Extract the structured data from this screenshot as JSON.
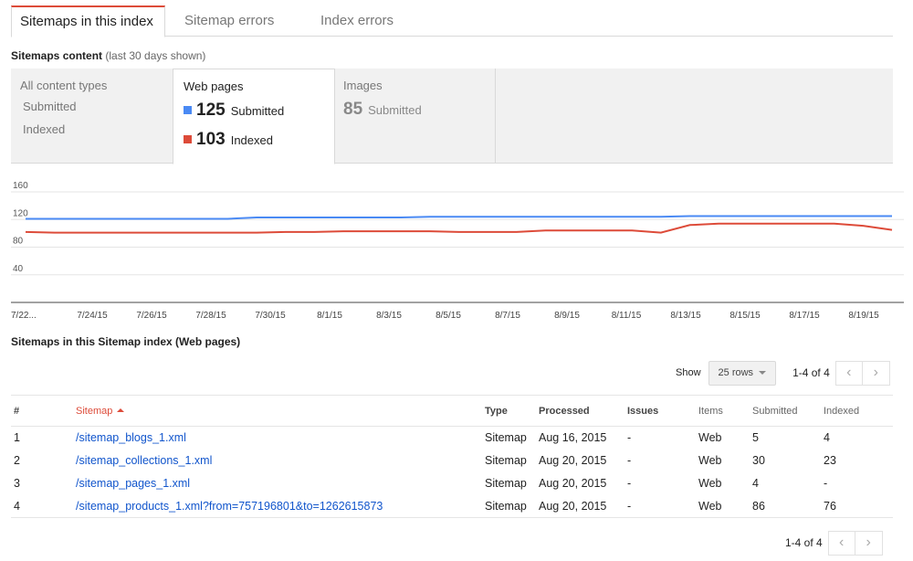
{
  "tabs": [
    {
      "label": "Sitemaps in this index",
      "active": true
    },
    {
      "label": "Sitemap errors",
      "active": false
    },
    {
      "label": "Index errors",
      "active": false
    }
  ],
  "content_section": {
    "title": "Sitemaps content",
    "subtitle": "(last 30 days shown)"
  },
  "content_types": {
    "all": {
      "label": "All content types",
      "submitted": "Submitted",
      "indexed": "Indexed"
    },
    "web": {
      "label": "Web pages",
      "submitted_value": "125",
      "submitted_label": "Submitted",
      "indexed_value": "103",
      "indexed_label": "Indexed"
    },
    "images": {
      "label": "Images",
      "submitted_value": "85",
      "submitted_label": "Submitted"
    }
  },
  "colors": {
    "submitted": "#4a8af4",
    "indexed": "#dd4b39",
    "accent": "#dd4b39",
    "link": "#1155cc"
  },
  "chart_data": {
    "type": "line",
    "ylim": [
      0,
      160
    ],
    "yticks": [
      "160",
      "120",
      "80",
      "40"
    ],
    "xticks": [
      "7/22...",
      "7/24/15",
      "7/26/15",
      "7/28/15",
      "7/30/15",
      "8/1/15",
      "8/3/15",
      "8/5/15",
      "8/7/15",
      "8/9/15",
      "8/11/15",
      "8/13/15",
      "8/15/15",
      "8/17/15",
      "8/19/15"
    ],
    "series": [
      {
        "name": "Submitted",
        "values": [
          121,
          121,
          121,
          121,
          121,
          121,
          121,
          121,
          123,
          123,
          123,
          123,
          123,
          123,
          124,
          124,
          124,
          124,
          124,
          124,
          124,
          124,
          124,
          125,
          125,
          125,
          125,
          125,
          125,
          125,
          125
        ]
      },
      {
        "name": "Indexed",
        "values": [
          102,
          101,
          101,
          101,
          101,
          101,
          101,
          101,
          101,
          102,
          102,
          103,
          103,
          103,
          103,
          102,
          102,
          102,
          104,
          104,
          104,
          104,
          101,
          112,
          114,
          114,
          114,
          114,
          114,
          111,
          105
        ]
      }
    ]
  },
  "list": {
    "title": "Sitemaps in this Sitemap index (Web pages)"
  },
  "pager": {
    "show_label": "Show",
    "rows_label": "25 rows",
    "range": "1-4 of 4",
    "prev": "‹",
    "next": "›"
  },
  "table": {
    "headers": {
      "num": "#",
      "sitemap": "Sitemap",
      "type": "Type",
      "processed": "Processed",
      "issues": "Issues",
      "items": "Items",
      "submitted": "Submitted",
      "indexed": "Indexed"
    },
    "rows": [
      {
        "num": "1",
        "sitemap": "/sitemap_blogs_1.xml",
        "type": "Sitemap",
        "processed": "Aug 16, 2015",
        "issues": "-",
        "items": "Web",
        "submitted": "5",
        "indexed": "4"
      },
      {
        "num": "2",
        "sitemap": "/sitemap_collections_1.xml",
        "type": "Sitemap",
        "processed": "Aug 20, 2015",
        "issues": "-",
        "items": "Web",
        "submitted": "30",
        "indexed": "23"
      },
      {
        "num": "3",
        "sitemap": "/sitemap_pages_1.xml",
        "type": "Sitemap",
        "processed": "Aug 20, 2015",
        "issues": "-",
        "items": "Web",
        "submitted": "4",
        "indexed": "-"
      },
      {
        "num": "4",
        "sitemap": "/sitemap_products_1.xml?from=757196801&to=1262615873",
        "type": "Sitemap",
        "processed": "Aug 20, 2015",
        "issues": "-",
        "items": "Web",
        "submitted": "86",
        "indexed": "76"
      }
    ]
  }
}
